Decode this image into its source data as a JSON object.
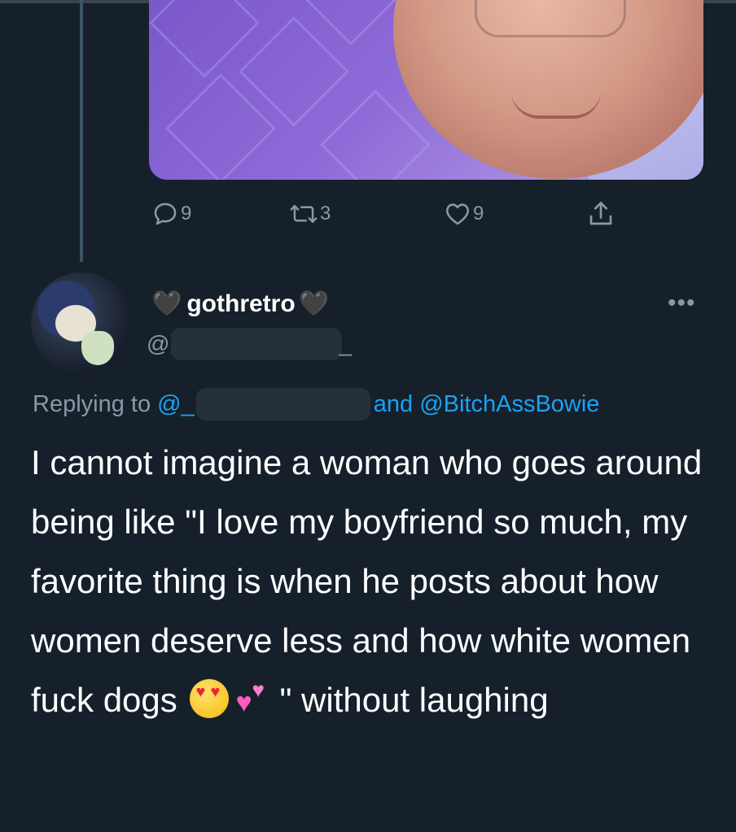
{
  "parent_tweet": {
    "stats": {
      "replies": "9",
      "retweets": "3",
      "likes": "9"
    }
  },
  "tweet": {
    "display_name": "gothretro",
    "name_decorations": [
      "black-heart-emoji",
      "black-heart-emoji"
    ],
    "handle_prefix": "@",
    "handle_suffix": "_",
    "replying_to_label": "Replying to",
    "replying_to_mention_prefix": "@_",
    "replying_to_and": "and",
    "replying_to_second": "@BitchAssBowie",
    "text_part1": "I cannot imagine a woman who goes around being like \"I love my boyfriend so much, my favorite thing is when he posts about how women deserve less and how white women fuck dogs",
    "text_emojis": [
      "heart-eyes-emoji",
      "two-hearts-emoji"
    ],
    "text_part2": "\" without laughing"
  },
  "icons": {
    "reply": "reply-icon",
    "retweet": "retweet-icon",
    "like": "like-icon",
    "share": "share-icon",
    "more": "more-icon"
  },
  "colors": {
    "background": "#15202b",
    "muted": "#8899a6",
    "link": "#1da1f2",
    "text": "#ffffff"
  }
}
